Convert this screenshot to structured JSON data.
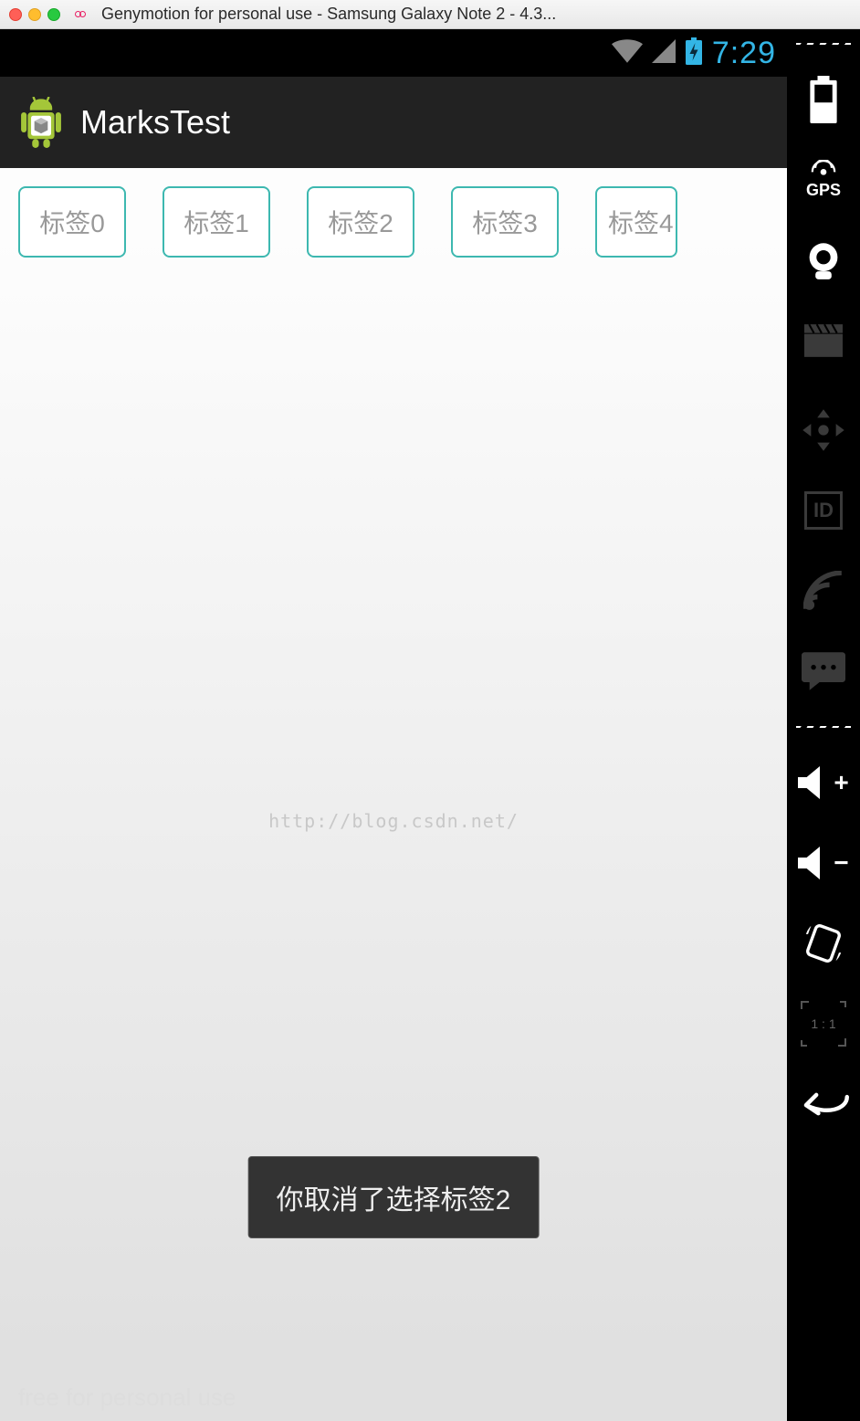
{
  "window": {
    "title": "Genymotion for personal use - Samsung Galaxy Note 2 - 4.3..."
  },
  "status_bar": {
    "time": "7:29"
  },
  "app": {
    "title": "MarksTest"
  },
  "tabs": [
    {
      "label": "标签0"
    },
    {
      "label": "标签1"
    },
    {
      "label": "标签2"
    },
    {
      "label": "标签3"
    },
    {
      "label": "标签4"
    }
  ],
  "watermark": "http://blog.csdn.net/",
  "toast": "你取消了选择标签2",
  "footer": "free for personal use",
  "sidebar": {
    "gps_label": "GPS",
    "id_label": "ID",
    "ratio_label": "1 : 1"
  }
}
